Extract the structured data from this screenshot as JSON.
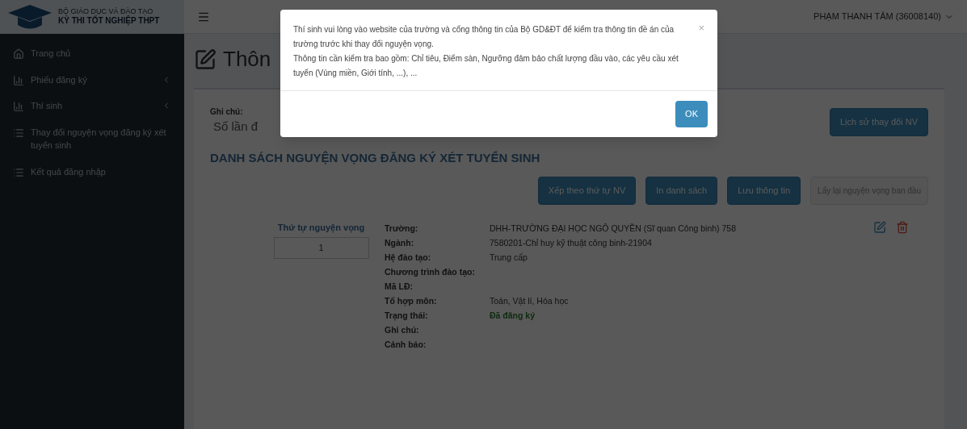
{
  "header": {
    "logo_line_1": "BỘ GIÁO DỤC VÀ ĐÀO TẠO",
    "logo_line_2": "KỲ THI TỐT NGHIỆP THPT",
    "user": "PHẠM THANH TÂM (36008140)"
  },
  "sidebar": {
    "items": [
      {
        "label": "Trang chủ",
        "has_submenu": false
      },
      {
        "label": "Phiếu đăng ký",
        "has_submenu": true
      },
      {
        "label": "Thí sinh",
        "has_submenu": true
      },
      {
        "label": "Thay đổi nguyện vọng đăng ký xét tuyển sinh",
        "has_submenu": false
      },
      {
        "label": "Kết quả đăng nhập",
        "has_submenu": false
      }
    ]
  },
  "page": {
    "title": "Thôn",
    "note_label": "Ghi chú:",
    "note_text": "Số lần đ",
    "history_button": "Lịch sử thay đổi NV",
    "list_title": "DANH SÁCH NGUYỆN VỌNG ĐĂNG KÝ XÉT TUYỂN SINH",
    "actions": [
      {
        "label": "Xếp theo thứ tự NV",
        "disabled": false
      },
      {
        "label": "In danh sách",
        "disabled": false
      },
      {
        "label": "Lưu thông tin",
        "disabled": false
      },
      {
        "label": "Lấy lại nguyện vọng ban đầu",
        "disabled": true
      }
    ],
    "wish": {
      "order_label": "Thứ tự nguyện vọng",
      "order_value": "1",
      "fields": [
        {
          "label": "Trường:",
          "value": "DHH-TRƯỜNG ĐẠI HỌC NGÔ QUYỀN (Sĩ quan Công binh) 758",
          "kind": "text"
        },
        {
          "label": "Ngành:",
          "value": "7580201-Chỉ huy kỹ thuật công binh-21904",
          "kind": "text"
        },
        {
          "label": "Hệ đào tạo:",
          "value": "Trung cấp",
          "kind": "text"
        },
        {
          "label": "Chương trình đào tạo:",
          "kind": "text"
        },
        {
          "label": "Mã LĐ:",
          "kind": "text"
        },
        {
          "label": "Tổ hợp môn:",
          "value": "Toán, Vật lí, Hóa học",
          "kind": "text"
        },
        {
          "label": "Trạng thái:",
          "value": "Đã đăng ký",
          "kind": "status"
        },
        {
          "label": "Ghi chú:",
          "kind": "text"
        },
        {
          "label": "Cảnh báo:",
          "kind": "text"
        }
      ]
    }
  },
  "modal": {
    "close": "×",
    "paragraphs": [
      "Thí sinh vui lòng vào website của trường và cổng thông tin của Bộ GD&ĐT để kiểm tra thông tin đề án của trường trước khi thay đổi nguyện vọng.",
      "Thông tin cần kiểm tra bao gồm: Chỉ tiêu, Điểm sàn, Ngưỡng đảm bảo chất lượng đầu vào, các yêu cầu xét tuyển (Vùng miền, Giới tính, ...), ..."
    ],
    "ok_button": "OK"
  }
}
